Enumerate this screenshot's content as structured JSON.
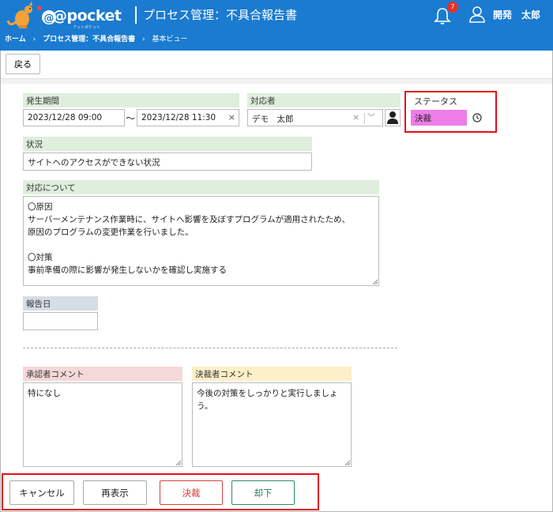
{
  "header": {
    "logo_text": "@pocket",
    "logo_subtext": "アットポケット",
    "app_title": "プロセス管理：不具合報告書",
    "notification_count": "7",
    "user_name": "開発　太郎"
  },
  "breadcrumb": [
    "ホーム",
    "›",
    "プロセス管理：不具合報告書",
    "›",
    "基本ビュー"
  ],
  "toolbar": {
    "back_label": "戻る"
  },
  "form": {
    "period": {
      "label": "発生期間",
      "start": "2023/12/28 09:00",
      "separator": "～",
      "end": "2023/12/28 11:30",
      "clear": "×"
    },
    "responder": {
      "label": "対応者",
      "value": "デモ　太郎",
      "clear": "×",
      "dropdown": "﹀"
    },
    "status": {
      "label": "ステータス",
      "value": "決裁",
      "chip_color": "#ee7de8"
    },
    "situation": {
      "label": "状況",
      "value": "サイトへのアクセスができない状況"
    },
    "response": {
      "label": "対応について",
      "lines": [
        "〇原因",
        "サーバーメンテナンス作業時に、サイトへ影響を及ぼすプログラムが適用されたため、",
        "原因のプログラムの変更作業を行いました。",
        "",
        "〇対策",
        "事前準備の際に影響が発生しないかを確認し実施する"
      ]
    },
    "report_date": {
      "label": "報告日",
      "value": ""
    },
    "approver_comment": {
      "label": "承認者コメント",
      "value": "特になし"
    },
    "decider_comment": {
      "label": "決裁者コメント",
      "value": "今後の対策をしっかりと実行しましょう。"
    }
  },
  "actions": {
    "cancel": "キャンセル",
    "refresh": "再表示",
    "approve": "決裁",
    "reject": "却下"
  },
  "colors": {
    "header_bg": "#1a7bd0",
    "highlight_border": "#e3101a",
    "status_chip": "#ee7de8"
  }
}
